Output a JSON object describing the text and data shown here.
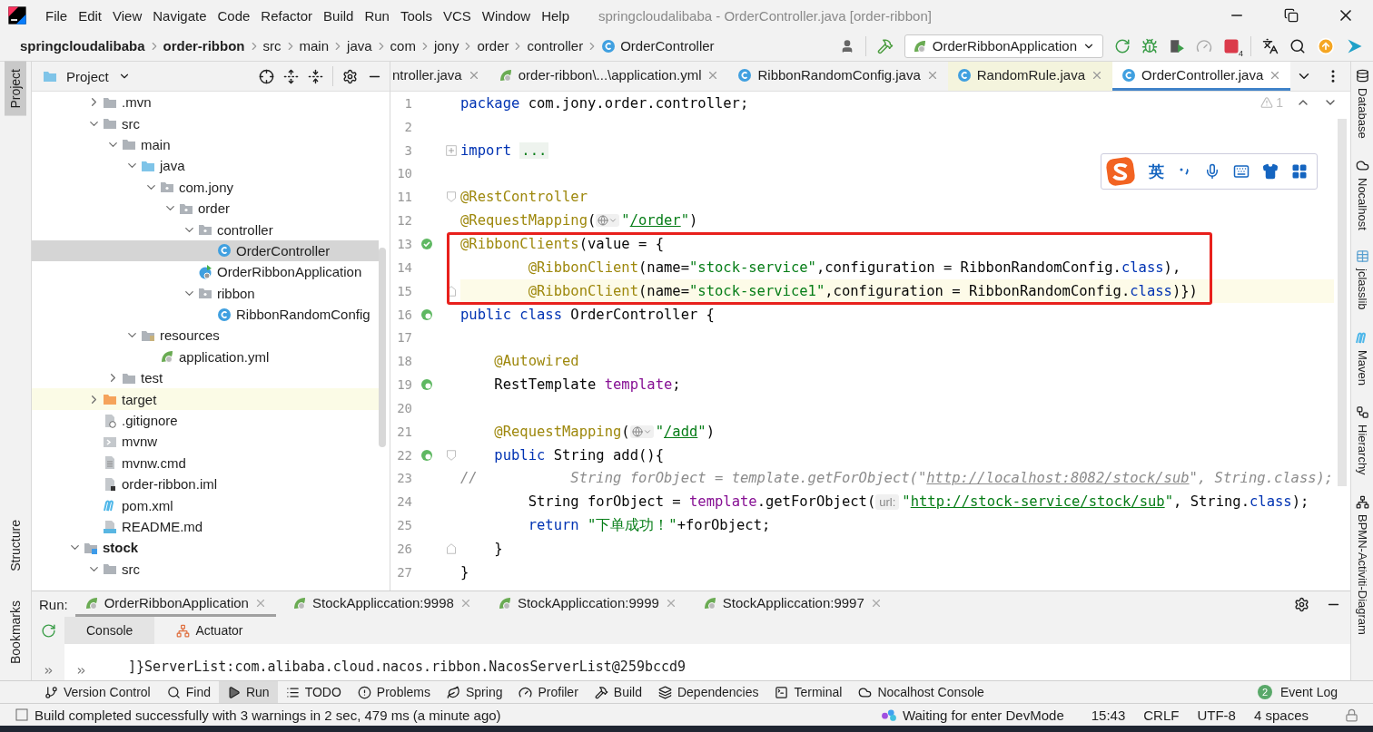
{
  "window": {
    "title": "springcloudalibaba - OrderController.java [order-ribbon]"
  },
  "menu": [
    "File",
    "Edit",
    "View",
    "Navigate",
    "Code",
    "Refactor",
    "Build",
    "Run",
    "Tools",
    "VCS",
    "Window",
    "Help"
  ],
  "breadcrumbs": [
    {
      "label": "springcloudalibaba",
      "kind": "project"
    },
    {
      "label": "order-ribbon",
      "kind": "module"
    },
    {
      "label": "src",
      "kind": "folder"
    },
    {
      "label": "main",
      "kind": "folder"
    },
    {
      "label": "java",
      "kind": "folder"
    },
    {
      "label": "com",
      "kind": "folder"
    },
    {
      "label": "jony",
      "kind": "folder"
    },
    {
      "label": "order",
      "kind": "folder"
    },
    {
      "label": "controller",
      "kind": "folder"
    },
    {
      "label": "OrderController",
      "kind": "class"
    }
  ],
  "toolbar": {
    "run_config": "OrderRibbonApplication",
    "stop_badge": "4"
  },
  "left_strip": [
    {
      "label": "Project",
      "selected": true
    },
    {
      "label": "Structure",
      "selected": false
    },
    {
      "label": "Bookmarks",
      "selected": false
    }
  ],
  "right_strip": [
    {
      "label": "Database",
      "kind": "database"
    },
    {
      "label": "Nocalhost",
      "kind": "cloud"
    },
    {
      "label": "jclasslib",
      "kind": "table"
    },
    {
      "label": "Maven",
      "kind": "maven"
    },
    {
      "label": "Hierarchy",
      "kind": "hierarchy"
    },
    {
      "label": "BPMN-Activiti-Diagram",
      "kind": "diagram"
    }
  ],
  "project_panel": {
    "title": "Project",
    "tree": [
      {
        "children": [
          {
            "label": ".mvn",
            "kind": "folder",
            "expanded": false,
            "selected": false
          },
          {
            "label": "src",
            "kind": "folder",
            "expanded": true,
            "selected": false,
            "children": [
              {
                "label": "main",
                "kind": "folder",
                "expanded": true,
                "selected": false,
                "children": [
                  {
                    "label": "java",
                    "kind": "source-folder",
                    "expanded": true,
                    "selected": false,
                    "children": [
                      {
                        "label": "com.jony",
                        "kind": "package",
                        "expanded": true,
                        "selected": false,
                        "children": [
                          {
                            "label": "order",
                            "kind": "package",
                            "expanded": true,
                            "selected": false,
                            "children": [
                              {
                                "label": "controller",
                                "kind": "package",
                                "expanded": true,
                                "selected": false,
                                "children": [
                                  {
                                    "label": "OrderController",
                                    "kind": "class",
                                    "selected": true
                                  }
                                ]
                              },
                              {
                                "label": "OrderRibbonApplication",
                                "kind": "spring-class",
                                "selected": false
                              },
                              {
                                "label": "ribbon",
                                "kind": "package",
                                "expanded": true,
                                "selected": false,
                                "children": [
                                  {
                                    "label": "RibbonRandomConfig",
                                    "kind": "class",
                                    "selected": false
                                  }
                                ]
                              }
                            ]
                          }
                        ]
                      }
                    ]
                  },
                  {
                    "label": "resources",
                    "kind": "resources",
                    "expanded": true,
                    "selected": false,
                    "children": [
                      {
                        "label": "application.yml",
                        "kind": "yml",
                        "selected": false
                      }
                    ]
                  }
                ]
              },
              {
                "label": "test",
                "kind": "folder",
                "expanded": false,
                "selected": false
              }
            ]
          },
          {
            "label": "target",
            "kind": "excluded-folder",
            "expanded": false,
            "selected": false,
            "ignored": true
          },
          {
            "label": ".gitignore",
            "kind": "ignore-file",
            "selected": false
          },
          {
            "label": "mvnw",
            "kind": "script",
            "selected": false
          },
          {
            "label": "mvnw.cmd",
            "kind": "text-file",
            "selected": false
          },
          {
            "label": "order-ribbon.iml",
            "kind": "iml",
            "selected": false
          },
          {
            "label": "pom.xml",
            "kind": "maven",
            "selected": false
          },
          {
            "label": "README.md",
            "kind": "markdown",
            "selected": false
          }
        ]
      },
      {
        "label": "stock",
        "kind": "module",
        "expanded": true,
        "selected": false,
        "children": [
          {
            "label": "src",
            "kind": "folder",
            "expanded": true,
            "selected": false
          }
        ]
      }
    ]
  },
  "editor": {
    "tabs": [
      {
        "label": "ntroller.java",
        "kind": "class",
        "selected": false
      },
      {
        "label": "order-ribbon\\...\\application.yml",
        "kind": "yml",
        "selected": false
      },
      {
        "label": "RibbonRandomConfig.java",
        "kind": "class",
        "selected": false
      },
      {
        "label": "RandomRule.java",
        "kind": "library-class",
        "selected": false
      },
      {
        "label": "OrderController.java",
        "kind": "class",
        "selected": true
      }
    ],
    "warnings": "1",
    "lines": [
      {
        "number": "1",
        "tokens": [
          {
            "text": "package",
            "kind": "keyword"
          },
          {
            "text": " com.jony.order.controller;",
            "kind": "plain"
          }
        ]
      },
      {
        "number": "2"
      },
      {
        "number": "3",
        "fold": {
          "kind": "collapsed"
        },
        "tokens": [
          {
            "text": "import ",
            "kind": "keyword"
          },
          {
            "text": "...",
            "kind": "folded"
          }
        ]
      },
      {
        "number": "10"
      },
      {
        "number": "11",
        "fold": {
          "kind": "start"
        },
        "tokens": [
          {
            "text": "@RestController",
            "kind": "annotation"
          }
        ]
      },
      {
        "number": "12",
        "tokens": [
          {
            "text": "@RequestMapping",
            "kind": "annotation"
          },
          {
            "text": "(",
            "kind": "plain"
          },
          {
            "kind": "globe-hint"
          },
          {
            "text": "\"",
            "kind": "string"
          },
          {
            "text": "/order",
            "kind": "url"
          },
          {
            "text": "\"",
            "kind": "string"
          },
          {
            "text": ")",
            "kind": "plain"
          }
        ]
      },
      {
        "number": "13",
        "gutter": {
          "kind": "config"
        },
        "boxed": true,
        "tokens": [
          {
            "text": "@RibbonClients",
            "kind": "annotation"
          },
          {
            "text": "(value = {",
            "kind": "plain"
          }
        ]
      },
      {
        "number": "14",
        "boxed": true,
        "tokens": [
          {
            "text": "        @RibbonClient",
            "kind": "annotation"
          },
          {
            "text": "(name=",
            "kind": "plain"
          },
          {
            "text": "\"stock-service\"",
            "kind": "string"
          },
          {
            "text": ",configuration = RibbonRandomConfig.",
            "kind": "plain"
          },
          {
            "text": "class",
            "kind": "keyword"
          },
          {
            "text": "),",
            "kind": "plain"
          }
        ]
      },
      {
        "number": "15",
        "fold": {
          "kind": "end"
        },
        "current": true,
        "boxed": true,
        "tokens": [
          {
            "text": "        @RibbonClient",
            "kind": "annotation"
          },
          {
            "text": "(name=",
            "kind": "plain"
          },
          {
            "text": "\"stock-service1\"",
            "kind": "string"
          },
          {
            "text": ",configuration = RibbonRandomConfig.",
            "kind": "plain"
          },
          {
            "text": "class",
            "kind": "keyword"
          },
          {
            "text": ")})",
            "kind": "plain"
          }
        ]
      },
      {
        "number": "16",
        "gutter": {
          "kind": "bean"
        },
        "tokens": [
          {
            "text": "public class",
            "kind": "keyword"
          },
          {
            "text": " OrderController {",
            "kind": "plain"
          }
        ]
      },
      {
        "number": "17"
      },
      {
        "number": "18",
        "tokens": [
          {
            "text": "    @Autowired",
            "kind": "annotation"
          }
        ]
      },
      {
        "number": "19",
        "gutter": {
          "kind": "bean"
        },
        "tokens": [
          {
            "text": "    RestTemplate ",
            "kind": "plain"
          },
          {
            "text": "template",
            "kind": "field"
          },
          {
            "text": ";",
            "kind": "plain"
          }
        ]
      },
      {
        "number": "20"
      },
      {
        "number": "21",
        "tokens": [
          {
            "text": "    @RequestMapping",
            "kind": "annotation"
          },
          {
            "text": "(",
            "kind": "plain"
          },
          {
            "kind": "globe-hint"
          },
          {
            "text": "\"",
            "kind": "string"
          },
          {
            "text": "/add",
            "kind": "url"
          },
          {
            "text": "\"",
            "kind": "string"
          },
          {
            "text": ")",
            "kind": "plain"
          }
        ]
      },
      {
        "number": "22",
        "gutter": {
          "kind": "bean"
        },
        "fold": {
          "kind": "start"
        },
        "tokens": [
          {
            "text": "    public",
            "kind": "keyword"
          },
          {
            "text": " String add(){",
            "kind": "plain"
          }
        ]
      },
      {
        "number": "23",
        "tokens": [
          {
            "text": "//",
            "kind": "comment"
          },
          {
            "text": "           String forObject = template.getForObject(\"",
            "kind": "comment"
          },
          {
            "text": "http://localhost:8082/stock/sub",
            "kind": "comment-url"
          },
          {
            "text": "\", String.class);",
            "kind": "comment"
          }
        ]
      },
      {
        "number": "24",
        "tokens": [
          {
            "text": "        String forObject = ",
            "kind": "plain"
          },
          {
            "text": "template",
            "kind": "field"
          },
          {
            "text": ".getForObject(",
            "kind": "plain"
          },
          {
            "text": "url:",
            "kind": "inlay"
          },
          {
            "text": "\"",
            "kind": "string"
          },
          {
            "text": "http://stock-service/stock/sub",
            "kind": "url"
          },
          {
            "text": "\"",
            "kind": "string"
          },
          {
            "text": ", String.",
            "kind": "plain"
          },
          {
            "text": "class",
            "kind": "keyword"
          },
          {
            "text": ");",
            "kind": "plain"
          }
        ]
      },
      {
        "number": "25",
        "tokens": [
          {
            "text": "        return ",
            "kind": "keyword"
          },
          {
            "text": "\"下单成功！\"",
            "kind": "string"
          },
          {
            "text": "+forObject;",
            "kind": "plain"
          }
        ]
      },
      {
        "number": "26",
        "fold": {
          "kind": "end"
        },
        "tokens": [
          {
            "text": "    }",
            "kind": "plain"
          }
        ]
      },
      {
        "number": "27",
        "tokens": [
          {
            "text": "}",
            "kind": "plain"
          }
        ]
      }
    ]
  },
  "ime": {
    "mode": "英"
  },
  "run": {
    "label": "Run:",
    "tabs": [
      {
        "label": "OrderRibbonApplication",
        "selected": true
      },
      {
        "label": "StockAppliccation:9998",
        "selected": false
      },
      {
        "label": "StockAppliccation:9999",
        "selected": false
      },
      {
        "label": "StockAppliccation:9997",
        "selected": false
      }
    ],
    "subtabs": [
      {
        "label": "Console",
        "kind": "console",
        "selected": true
      },
      {
        "label": "Actuator",
        "kind": "actuator",
        "selected": false
      }
    ],
    "console": [
      "]}ServerList:com.alibaba.cloud.nacos.ribbon.NacosServerList@259bccd9"
    ]
  },
  "tool_bar": {
    "items": [
      {
        "label": "Version Control",
        "kind": "branch",
        "selected": false
      },
      {
        "label": "Find",
        "kind": "search",
        "selected": false
      },
      {
        "label": "Run",
        "kind": "run",
        "selected": true
      },
      {
        "label": "TODO",
        "kind": "list",
        "selected": false
      },
      {
        "label": "Problems",
        "kind": "problems",
        "selected": false
      },
      {
        "label": "Spring",
        "kind": "leaf",
        "selected": false
      },
      {
        "label": "Profiler",
        "kind": "profiler",
        "selected": false
      },
      {
        "label": "Build",
        "kind": "hammer",
        "selected": false
      },
      {
        "label": "Dependencies",
        "kind": "layers",
        "selected": false
      },
      {
        "label": "Terminal",
        "kind": "terminal",
        "selected": false
      },
      {
        "label": "Nocalhost Console",
        "kind": "cloud",
        "selected": false
      }
    ],
    "event_log": {
      "label": "Event Log",
      "badge": "2"
    }
  },
  "status_bar": {
    "message": "Build completed successfully with 3 warnings in 2 sec, 479 ms (a minute ago)",
    "devmode": "Waiting for enter DevMode",
    "items": [
      "15:43",
      "CRLF",
      "UTF-8",
      "4 spaces"
    ]
  }
}
